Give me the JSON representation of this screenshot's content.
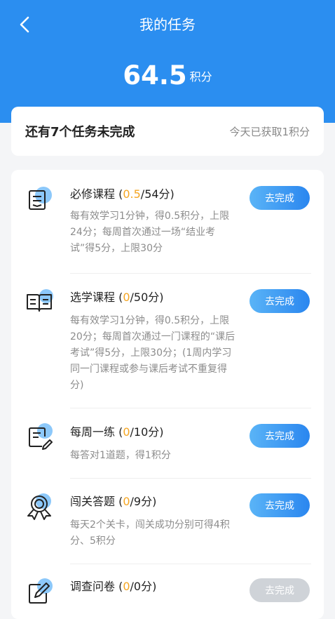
{
  "header": {
    "title": "我的任务",
    "points_value": "64.5",
    "points_unit": "积分"
  },
  "summary": {
    "remaining_text": "还有7个任务未完成",
    "today_text": "今天已获取1积分"
  },
  "tasks": [
    {
      "name": "必修课程",
      "open": " (",
      "earned": "0.5",
      "total": "/54分)",
      "desc": "每有效学习1分钟，得0.5积分，上限24分；每周首次通过一场“结业考试”得5分，上限30分",
      "button": "去完成",
      "icon": "document-icon"
    },
    {
      "name": "选学课程",
      "open": " (",
      "earned": "0",
      "total": "/50分)",
      "desc": "每有效学习1分钟，得0.5积分，上限20分；每周首次通过一门课程的“课后考试”得5分，上限30分；(1周内学习同一门课程或参与课后考试不重复得分)",
      "button": "去完成",
      "icon": "book-icon"
    },
    {
      "name": "每周一练",
      "open": " (",
      "earned": "0",
      "total": "/10分)",
      "desc": "每答对1道题，得1积分",
      "button": "去完成",
      "icon": "edit-note-icon"
    },
    {
      "name": "闯关答题",
      "open": " (",
      "earned": "0",
      "total": "/9分)",
      "desc": "每天2个关卡，闯关成功分别可得4积分、5积分",
      "button": "去完成",
      "icon": "medal-icon"
    },
    {
      "name": "调查问卷",
      "open": " (",
      "earned": "0",
      "total": "/0分)",
      "desc": "",
      "button": "去完成",
      "icon": "pencil-survey-icon"
    }
  ],
  "colors": {
    "primary": "#2b8ef0",
    "highlight": "#f5a623",
    "disabled": "#cfd3d8"
  }
}
